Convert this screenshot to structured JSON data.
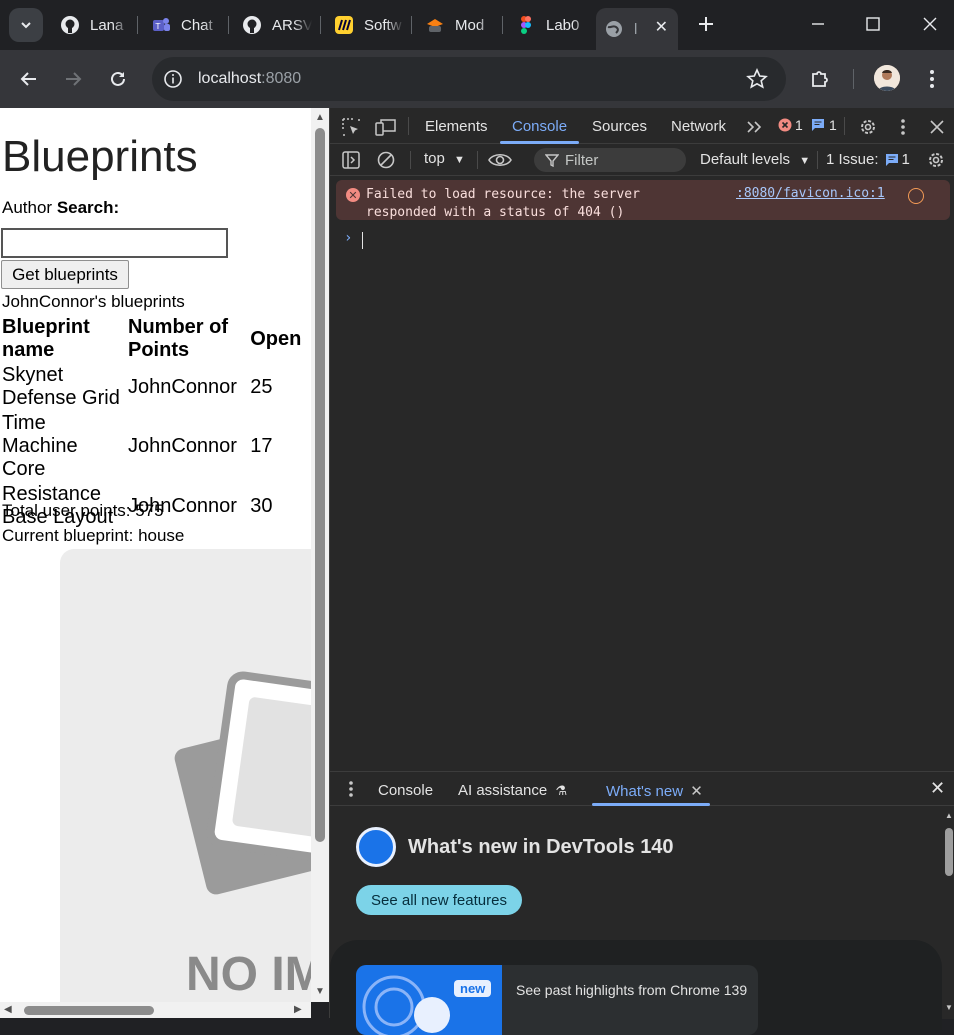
{
  "tabs": [
    {
      "label": "Lana",
      "icon": "github-icon"
    },
    {
      "label": "Chat",
      "icon": "teams-icon"
    },
    {
      "label": "ARSV",
      "icon": "github-icon"
    },
    {
      "label": "Softw",
      "icon": "miro-icon"
    },
    {
      "label": "Mod",
      "icon": "moodle-icon"
    },
    {
      "label": "Lab0",
      "icon": "figma-icon"
    },
    {
      "label": "l",
      "icon": "globe-icon",
      "active": true
    }
  ],
  "toolbar": {
    "url_host": "localhost",
    "url_port": ":8080"
  },
  "page": {
    "title": "Blueprints",
    "author_label": "Author ",
    "search_label": "Search:",
    "search_value": "",
    "get_button": "Get blueprints",
    "owner_heading": "JohnConnor's blueprints",
    "columns": [
      "Blueprint name",
      "Number of Points",
      "Open"
    ],
    "rows": [
      {
        "name": "Skynet Defense Grid",
        "author": "JohnConnor",
        "points": "25"
      },
      {
        "name": "Time Machine Core",
        "author": "JohnConnor",
        "points": "17"
      },
      {
        "name": "Resistance Base Layout",
        "author": "JohnConnor",
        "points": "30"
      }
    ],
    "total_points": "Total user points: 575",
    "current_blueprint": "Current blueprint: house",
    "no_image_text": "NO IM"
  },
  "devtools": {
    "tabs": [
      "Elements",
      "Console",
      "Sources",
      "Network"
    ],
    "active_tab": "Console",
    "error_count": "1",
    "message_count": "1",
    "context": "top",
    "filter_placeholder": "Filter",
    "levels": "Default levels",
    "issues_label": "1 Issue:",
    "issues_count": "1",
    "error_message": "Failed to load resource: the server responded with a status of 404 ()",
    "error_source": ":8080/favicon.ico:1",
    "drawer_tabs": [
      "Console",
      "AI assistance",
      "What's new"
    ],
    "whatsnew_title": "What's new in DevTools 140",
    "whatsnew_button": "See all new features",
    "highlight_badge": "new",
    "highlight_text": "See past highlights from Chrome 139"
  },
  "colors": {
    "accent": "#7cacf8",
    "error_bg": "#4e3534",
    "whatsnew_button": "#7cd3e8"
  }
}
